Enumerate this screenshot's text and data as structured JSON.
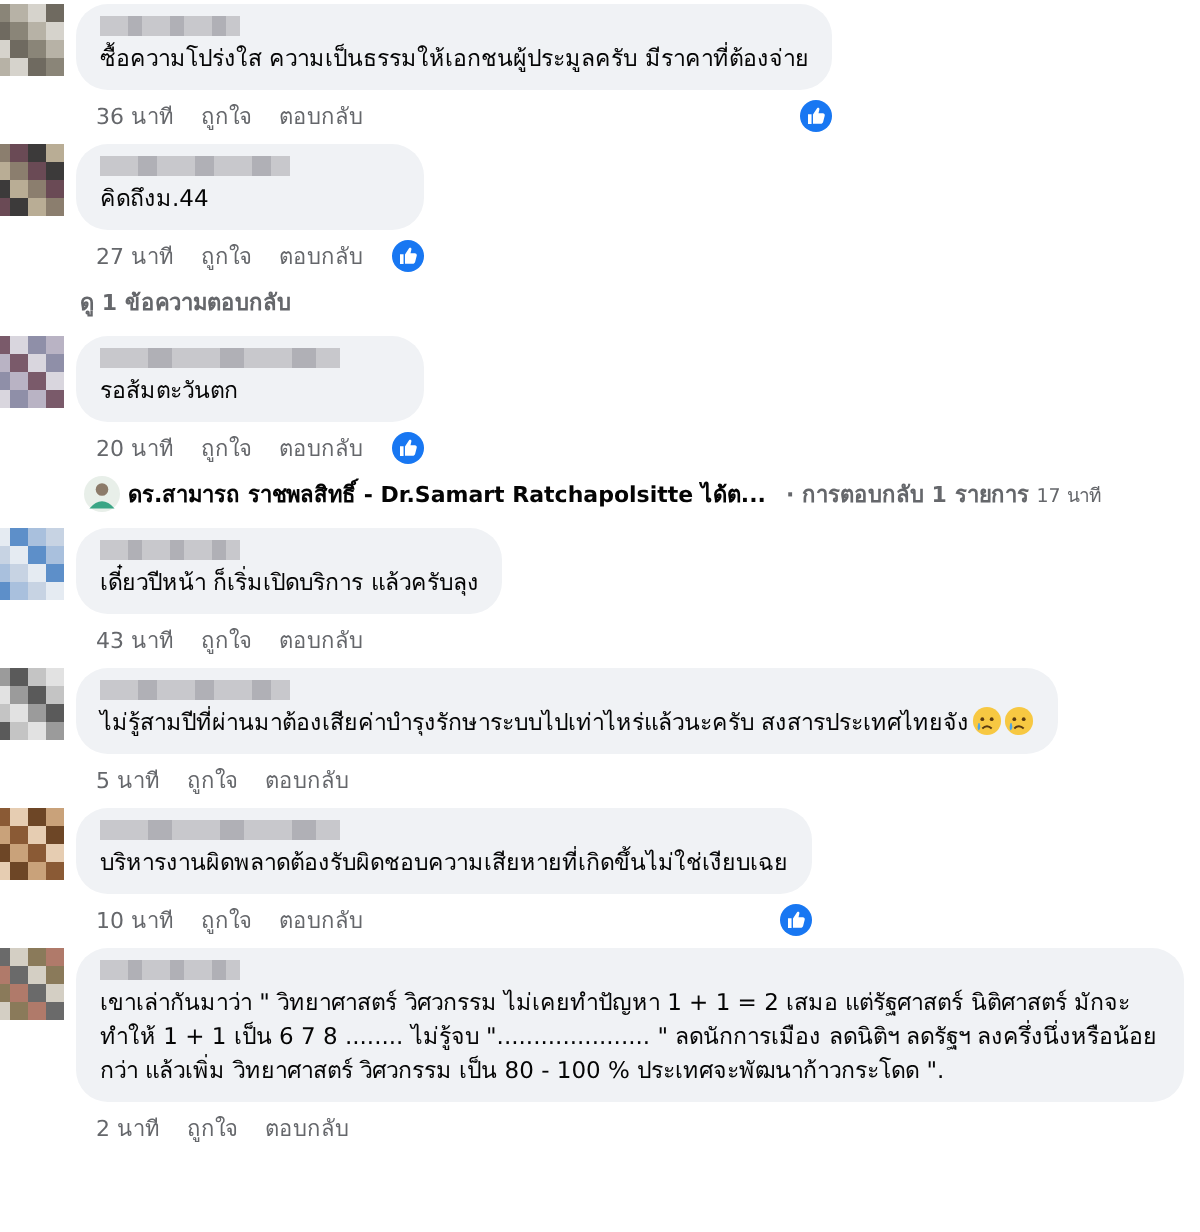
{
  "comments": [
    {
      "text": "ซื้อความโปร่งใส ความเป็นธรรมให้เอกชนผู้ประมูลครับ มีราคาที่ต้องจ่าย",
      "time": "36 นาที",
      "like": "ถูกใจ",
      "reply": "ตอบกลับ",
      "reacted": true
    },
    {
      "text": "คิดถึงม.44",
      "time": "27 นาที",
      "like": "ถูกใจ",
      "reply": "ตอบกลับ",
      "reacted": true,
      "view_replies": "ดู 1 ข้อความตอบกลับ"
    },
    {
      "text": "รอส้มตะวันตก",
      "time": "20 นาที",
      "like": "ถูกใจ",
      "reply": "ตอบกลับ",
      "reacted": true,
      "reply_summary": {
        "author": "ดร.สามารถ ราชพลสิทธิ์ - Dr.Samart Ratchapolsitte ได้ต...",
        "count": "· การตอบกลับ 1 รายการ",
        "time": "17 นาที"
      }
    },
    {
      "text": "เดี๋ยวปีหน้า ก็เริ่มเปิดบริการ แล้วครับลุง",
      "time": "43 นาที",
      "like": "ถูกใจ",
      "reply": "ตอบกลับ",
      "reacted": false
    },
    {
      "text": "ไม่รู้สามปีที่ผ่านมาต้องเสียค่าบำรุงรักษาระบบไปเท่าไหร่แล้วนะครับ สงสารประเทศไทยจัง",
      "emojis": [
        {
          "kind": "crying-face"
        },
        {
          "kind": "crying-face"
        }
      ],
      "time": "5 นาที",
      "like": "ถูกใจ",
      "reply": "ตอบกลับ",
      "reacted": false
    },
    {
      "text": "บริหารงานผิดพลาดต้องรับผิดชอบความเสียหายที่เกิดขึ้นไม่ใช่เงียบเฉย",
      "time": "10 นาที",
      "like": "ถูกใจ",
      "reply": "ตอบกลับ",
      "reacted": true
    },
    {
      "text": "เขาเล่ากันมาว่า \" วิทยาศาสตร์ วิศวกรรม ไม่เคยทำปัญหา 1 + 1 = 2 เสมอ แต่รัฐศาสตร์ นิติศาสตร์ มักจะทำให้ 1 + 1 เป็น 6 7 8 ........ ไม่รู้จบ \"..................... \" ลดนักการเมือง ลดนิติฯ ลดรัฐฯ ลงครึ่งนึ่งหรือน้อยกว่า แล้วเพิ่ม วิทยาศาสตร์ วิศวกรรม เป็น 80 - 100 % ประเทศจะพัฒนาก้าวกระโดด \".",
      "time": "2 นาที",
      "like": "ถูกใจ",
      "reply": "ตอบกลับ",
      "reacted": false
    }
  ]
}
